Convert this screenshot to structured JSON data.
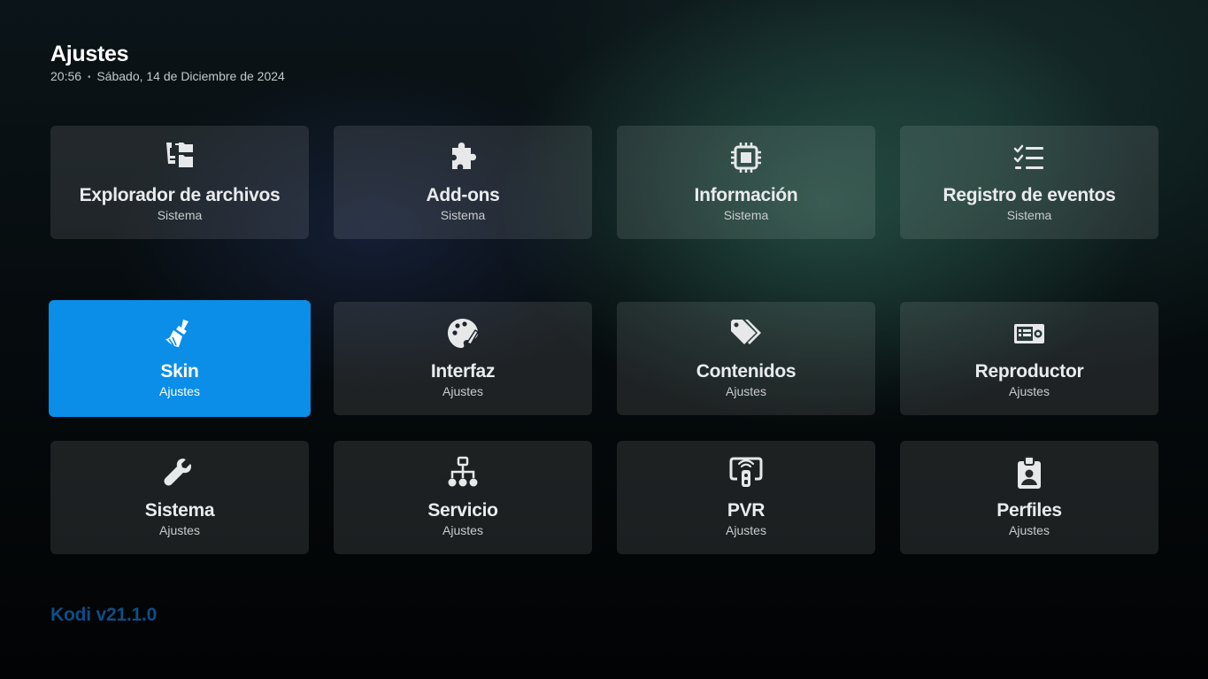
{
  "header": {
    "title": "Ajustes",
    "time": "20:56",
    "separator": "•",
    "date": "Sábado, 14 de Diciembre de 2024"
  },
  "tiles": [
    {
      "label": "Explorador de archivos",
      "sublabel": "Sistema",
      "icon": "file-manager-icon"
    },
    {
      "label": "Add-ons",
      "sublabel": "Sistema",
      "icon": "puzzle-icon"
    },
    {
      "label": "Información",
      "sublabel": "Sistema",
      "icon": "chip-icon"
    },
    {
      "label": "Registro de eventos",
      "sublabel": "Sistema",
      "icon": "checklist-icon"
    },
    {
      "label": "Skin",
      "sublabel": "Ajustes",
      "icon": "paint-brush-icon",
      "focused": true
    },
    {
      "label": "Interfaz",
      "sublabel": "Ajustes",
      "icon": "palette-icon"
    },
    {
      "label": "Contenidos",
      "sublabel": "Ajustes",
      "icon": "tags-icon"
    },
    {
      "label": "Reproductor",
      "sublabel": "Ajustes",
      "icon": "player-icon"
    },
    {
      "label": "Sistema",
      "sublabel": "Ajustes",
      "icon": "wrench-icon"
    },
    {
      "label": "Servicio",
      "sublabel": "Ajustes",
      "icon": "network-icon"
    },
    {
      "label": "PVR",
      "sublabel": "Ajustes",
      "icon": "tv-remote-icon"
    },
    {
      "label": "Perfiles",
      "sublabel": "Ajustes",
      "icon": "profile-badge-icon"
    }
  ],
  "footer": {
    "version": "Kodi v21.1.0"
  },
  "colors": {
    "focus": "#0a8ee8",
    "version_text": "#0d4e86"
  }
}
